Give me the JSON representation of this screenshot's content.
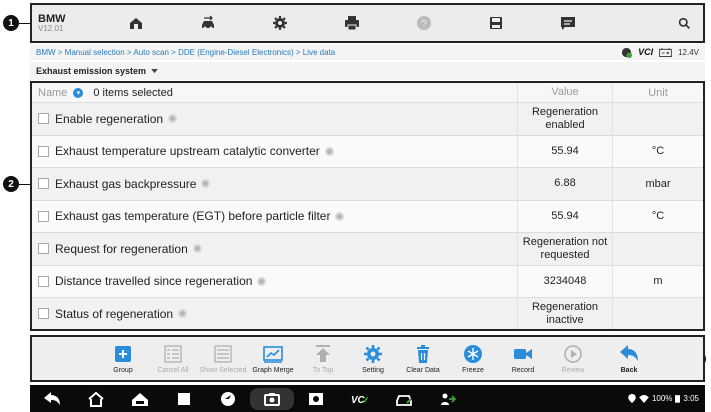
{
  "callouts": {
    "top": "1",
    "middle": "2",
    "bottom": "3"
  },
  "header": {
    "brand": "BMW",
    "version": "V12.01",
    "icons": [
      "home-icon",
      "vehicle-swap-icon",
      "settings-icon",
      "print-icon",
      "help-icon",
      "save-icon",
      "message-icon",
      "search-icon"
    ]
  },
  "breadcrumb": "BMW > Manual selection > Auto scan > DDE (Engine-Diesel Electronics) > Live data",
  "status": {
    "vci": "VCI",
    "voltage": "12.4V"
  },
  "system_selector": "Exhaust emission system",
  "table": {
    "headers": {
      "name": "Name",
      "selected": "0 items selected",
      "value": "Value",
      "unit": "Unit"
    },
    "rows": [
      {
        "name": "Enable regeneration",
        "value": "Regeneration enabled",
        "unit": ""
      },
      {
        "name": "Exhaust temperature upstream catalytic converter",
        "value": "55.94",
        "unit": "°C"
      },
      {
        "name": "Exhaust gas backpressure",
        "value": "6.88",
        "unit": "mbar"
      },
      {
        "name": "Exhaust gas temperature (EGT) before particle filter",
        "value": "55.94",
        "unit": "°C"
      },
      {
        "name": "Request for regeneration",
        "value": "Regeneration not requested",
        "unit": ""
      },
      {
        "name": "Distance travelled since regeneration",
        "value": "3234048",
        "unit": "m"
      },
      {
        "name": "Status of regeneration",
        "value": "Regeneration inactive",
        "unit": ""
      }
    ]
  },
  "toolbar": {
    "group": "Group",
    "cancel_all": "Cancel All",
    "show_selected": "Show Selected",
    "graph_merge": "Graph Merge",
    "to_top": "To Top",
    "setting": "Setting",
    "clear_data": "Clear Data",
    "freeze": "Freeze",
    "record": "Record",
    "review": "Review",
    "back": "Back"
  },
  "system_bar": {
    "battery": "100%",
    "time": "3:05"
  },
  "colors": {
    "accent": "#2a8ddb",
    "dark": "#0a0a0a"
  }
}
